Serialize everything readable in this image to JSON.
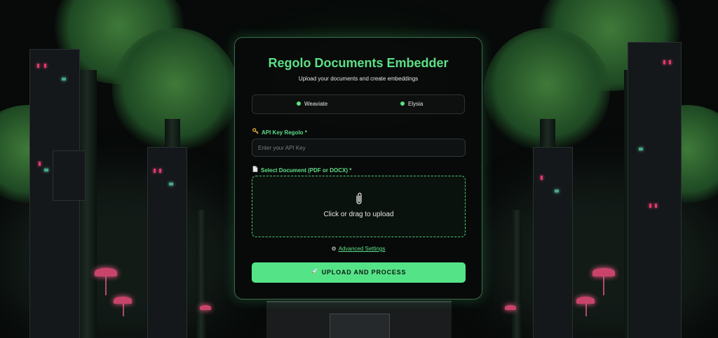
{
  "app": {
    "title": "Regolo Documents Embedder",
    "subtitle": "Upload your documents and create embeddings"
  },
  "tabs": [
    {
      "label": "Weaviate",
      "status_color": "#5ce087"
    },
    {
      "label": "Elysia",
      "status_color": "#5ce087"
    }
  ],
  "api_key": {
    "label": "API Key Regolo *",
    "icon": "key-icon",
    "placeholder": "Enter your API Key",
    "value": ""
  },
  "document": {
    "label": "Select Document (PDF or DOCX) *",
    "icon": "document-icon",
    "dropzone_icon": "paperclip-icon",
    "dropzone_text": "Click or drag to upload"
  },
  "advanced": {
    "label": "Advanced Settings",
    "icon": "gear-icon"
  },
  "submit": {
    "label": "UPLOAD AND PROCESS",
    "icon": "rocket-icon"
  },
  "colors": {
    "accent": "#5ce087",
    "button_bg": "#55e387",
    "card_bg": "#080a0a"
  }
}
